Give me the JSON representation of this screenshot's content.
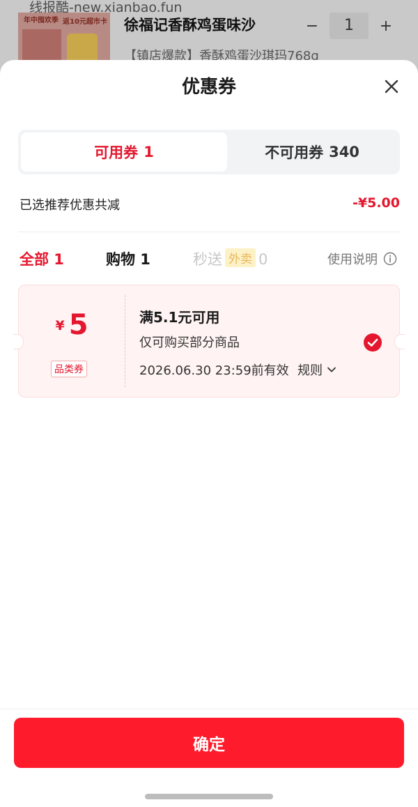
{
  "background": {
    "watermark": "线报酷-new.xianbao.fun",
    "thumb_text_1": "年中囤欢季",
    "thumb_text_2": "返10元超市卡",
    "product_title": "徐福记香酥鸡蛋味沙",
    "product_subtitle": "【镇店爆款】香酥鸡蛋沙琪玛768g",
    "stepper": {
      "minus": "−",
      "quantity": "1",
      "plus": "+"
    }
  },
  "sheet": {
    "title": "优惠券",
    "tabs": {
      "available": {
        "label": "可用券",
        "count": "1"
      },
      "unavailable": {
        "label": "不可用券",
        "count": "340"
      }
    },
    "saving": {
      "label": "已选推荐优惠共减",
      "amount": "-¥5.00"
    },
    "filters": {
      "all": "全部 1",
      "shopping": "购物 1",
      "miaosong_prefix": "秒送",
      "miaosong_badge": "外卖",
      "miaosong_count": "0",
      "help": "使用说明"
    },
    "coupon": {
      "currency": "¥",
      "amount": "5",
      "tag": "品类券",
      "condition": "满5.1元可用",
      "description": "仅可购买部分商品",
      "valid_until": "2026.06.30 23:59前有效",
      "rules": "规则"
    },
    "confirm": "确定"
  },
  "colors": {
    "accent": "#e4172e",
    "button": "#fe1b2c",
    "coupon_bg": "#fff3f3"
  }
}
